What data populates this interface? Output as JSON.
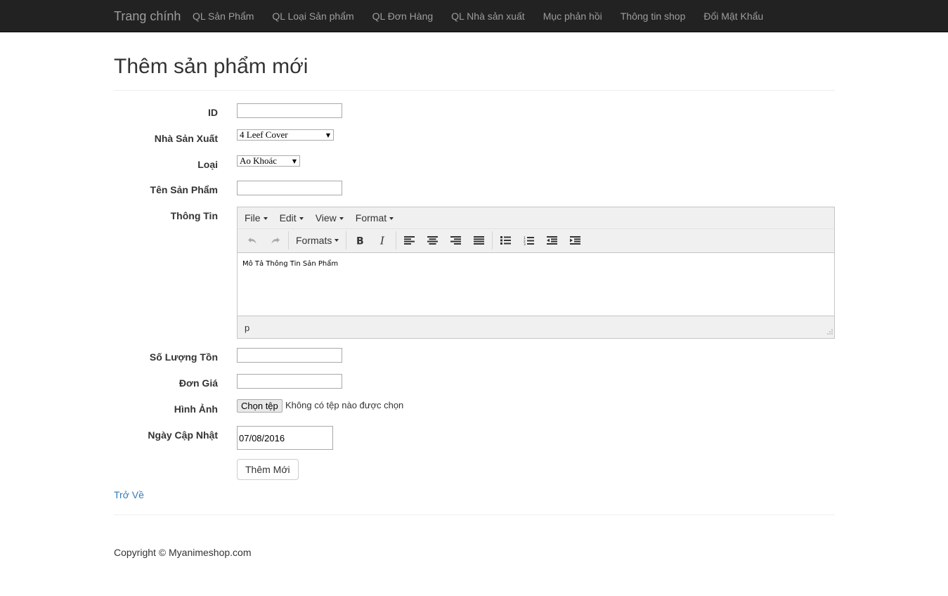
{
  "nav": {
    "brand": "Trang chính",
    "items": [
      "QL Sản Phẩm",
      "QL Loại Sản phẩm",
      "QL Đơn Hàng",
      "QL Nhà sản xuất",
      "Mục phản hồi",
      "Thông tin shop",
      "Đổi Mật Khẩu"
    ]
  },
  "page": {
    "title": "Thêm sản phẩm mới"
  },
  "form": {
    "id_label": "ID",
    "id_value": "",
    "maker_label": "Nhà Sản Xuất",
    "maker_value": "4 Leef Cover",
    "type_label": "Loại",
    "type_value": "Ao Khoác",
    "name_label": "Tên Sản Phẩm",
    "name_value": "",
    "info_label": "Thông Tin",
    "stock_label": "Số Lượng Tồn",
    "stock_value": "",
    "price_label": "Đơn Giá",
    "price_value": "",
    "image_label": "Hình Ảnh",
    "file_button": "Chọn tệp",
    "file_status": "Không có tệp nào được chọn",
    "date_label": "Ngày Cập Nhật",
    "date_value": "07/08/2016",
    "submit_label": "Thêm Mới"
  },
  "editor": {
    "menu": [
      "File",
      "Edit",
      "View",
      "Format"
    ],
    "formats_label": "Formats",
    "content": "Mô Tả Thông Tin Sản Phẩm",
    "status_path": "p",
    "icons": [
      "undo-icon",
      "redo-icon",
      "bold-icon",
      "italic-icon",
      "align-left-icon",
      "align-center-icon",
      "align-right-icon",
      "align-justify-icon",
      "bullet-list-icon",
      "numbered-list-icon",
      "outdent-icon",
      "indent-icon"
    ]
  },
  "links": {
    "back": "Trở Về"
  },
  "footer": {
    "copyright": "Copyright © Myanimeshop.com"
  },
  "colors": {
    "navbar": "#222222",
    "nav_text": "#9d9d9d",
    "link": "#337ab7",
    "editor_bg": "#f0f0f0"
  }
}
